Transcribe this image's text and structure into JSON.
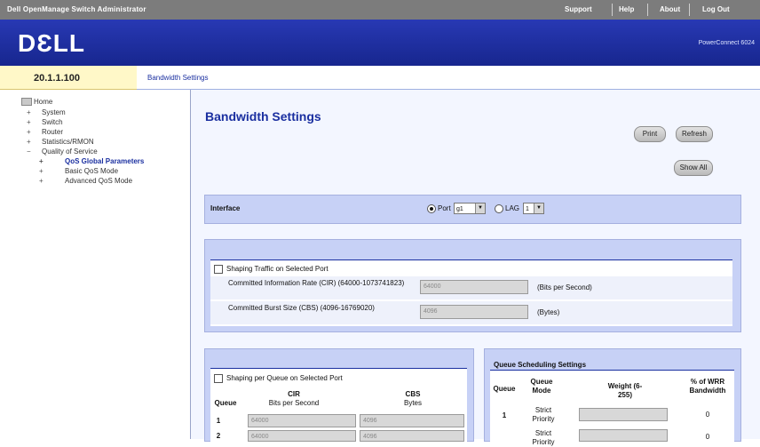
{
  "topbar": {
    "title": "Dell OpenManage Switch Administrator",
    "links": [
      "Support",
      "Help",
      "About",
      "Log Out"
    ]
  },
  "header": {
    "logo": "DƐLL",
    "product": "PowerConnect 6024"
  },
  "ip": "20.1.1.100",
  "breadcrumb": "Bandwidth Settings",
  "nav": {
    "items": [
      {
        "exp": "",
        "label": "Home"
      },
      {
        "exp": "+",
        "label": "System"
      },
      {
        "exp": "+",
        "label": "Switch"
      },
      {
        "exp": "+",
        "label": "Router"
      },
      {
        "exp": "+",
        "label": "Statistics/RMON"
      },
      {
        "exp": "−",
        "label": "Quality of Service"
      },
      {
        "exp": "+",
        "label": "QoS Global Parameters"
      },
      {
        "exp": "+",
        "label": "Basic QoS Mode"
      },
      {
        "exp": "+",
        "label": "Advanced QoS Mode"
      }
    ]
  },
  "page": {
    "title": "Bandwidth Settings",
    "buttons": {
      "print": "Print",
      "refresh": "Refresh",
      "show_all": "Show All"
    }
  },
  "interface": {
    "label": "Interface",
    "port_label": "Port",
    "port_value": "g1",
    "lag_label": "LAG",
    "lag_value": "1"
  },
  "shaping_port": {
    "checkbox_label": "Shaping Traffic on Selected Port",
    "cir_label": "Committed Information Rate (CIR) (64000-1073741823)",
    "cir_value": "64000",
    "cir_unit": "(Bits per Second)",
    "cbs_label": "Committed Burst Size (CBS) (4096-16769020)",
    "cbs_value": "4096",
    "cbs_unit": "(Bytes)"
  },
  "shaping_queue": {
    "checkbox_label": "Shaping per Queue on Selected Port",
    "col_queue": "Queue",
    "col_cir": "CIR",
    "col_cir_sub": "Bits per Second",
    "col_cbs": "CBS",
    "col_cbs_sub": "Bytes",
    "rows": [
      {
        "queue": "1",
        "cir": "64000",
        "cbs": "4096"
      },
      {
        "queue": "2",
        "cir": "64000",
        "cbs": "4096"
      }
    ]
  },
  "scheduling": {
    "title": "Queue Scheduling Settings",
    "col_queue": "Queue",
    "col_mode": "Queue Mode",
    "col_weight": "Weight (6-255)",
    "col_percent": "% of WRR Bandwidth",
    "rows": [
      {
        "queue": "1",
        "mode": "Strict Priority",
        "percent": "0"
      },
      {
        "queue": "2",
        "mode": "Strict Priority",
        "percent": "0"
      }
    ]
  }
}
